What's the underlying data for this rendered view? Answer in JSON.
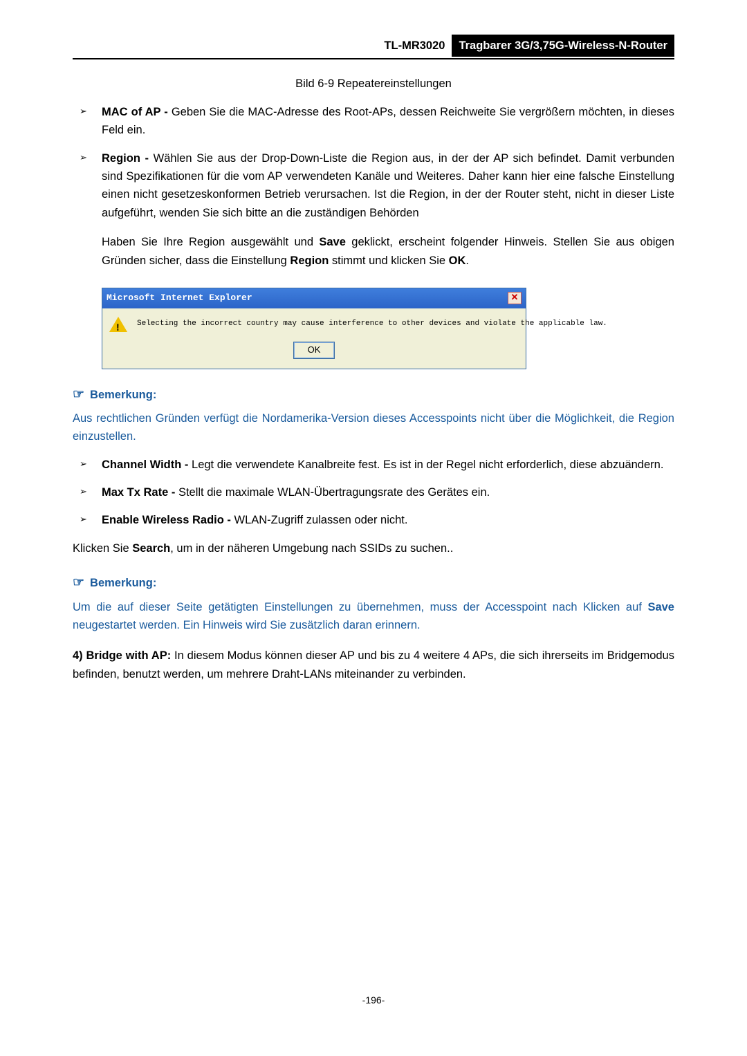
{
  "header": {
    "model": "TL-MR3020",
    "title": "Tragbarer 3G/3,75G-Wireless-N-Router"
  },
  "figure_caption": "Bild 6-9 Repeatereinstellungen",
  "items": {
    "mac_of_ap": {
      "label": "MAC of AP - ",
      "text": "Geben Sie die MAC-Adresse des Root-APs, dessen Reichweite Sie vergrößern möchten, in dieses Feld ein."
    },
    "region": {
      "label": "Region - ",
      "text": "Wählen Sie aus der Drop-Down-Liste die Region aus, in der der AP sich befindet. Damit verbunden sind Spezifikationen für die vom AP verwendeten Kanäle und Weiteres. Daher kann hier eine falsche Einstellung einen nicht gesetzeskonformen Betrieb verursachen. Ist die Region, in der der Router steht, nicht in dieser Liste aufgeführt, wenden Sie sich bitte an die zuständigen Behörden"
    },
    "region_sub": {
      "pre": "Haben Sie Ihre Region ausgewählt und ",
      "b1": "Save",
      "mid": " geklickt, erscheint folgender Hinweis. Stellen Sie aus obigen Gründen sicher, dass die Einstellung ",
      "b2": "Region",
      "post": " stimmt und klicken Sie ",
      "b3": "OK",
      "end": "."
    },
    "channel_width": {
      "label": "Channel Width - ",
      "text": "Legt die verwendete Kanalbreite fest. Es ist in der Regel nicht erforderlich, diese abzuändern."
    },
    "max_tx": {
      "label": "Max Tx Rate - ",
      "text": "Stellt die maximale WLAN-Übertragungsrate des Gerätes ein."
    },
    "enable_radio": {
      "label": "Enable Wireless Radio - ",
      "text": "WLAN-Zugriff zulassen oder nicht."
    }
  },
  "dialog": {
    "title": "Microsoft Internet Explorer",
    "close": "✕",
    "message": "Selecting the incorrect country may cause interference to other devices and violate the applicable law.",
    "ok": "OK"
  },
  "note1": {
    "heading": "Bemerkung:",
    "body": "Aus rechtlichen Gründen verfügt die Nordamerika-Version dieses Accesspoints nicht über die Möglichkeit, die Region einzustellen."
  },
  "search_para": {
    "pre": "Klicken Sie ",
    "b": "Search",
    "post": ", um in der näheren Umgebung nach SSIDs zu suchen.."
  },
  "note2": {
    "heading": "Bemerkung:",
    "pre": "Um die auf dieser Seite getätigten Einstellungen zu übernehmen, muss der Accesspoint nach Klicken auf ",
    "b": "Save",
    "post": " neugestartet werden. Ein Hinweis wird Sie zusätzlich daran erinnern."
  },
  "bridge": {
    "num": "4)",
    "label": " Bridge with AP:",
    "text": " In diesem Modus können dieser AP und bis zu 4 weitere 4 APs, die sich ihrerseits im Bridgemodus befinden, benutzt werden, um mehrere Draht-LANs miteinander zu verbinden."
  },
  "page_num": "-196-"
}
